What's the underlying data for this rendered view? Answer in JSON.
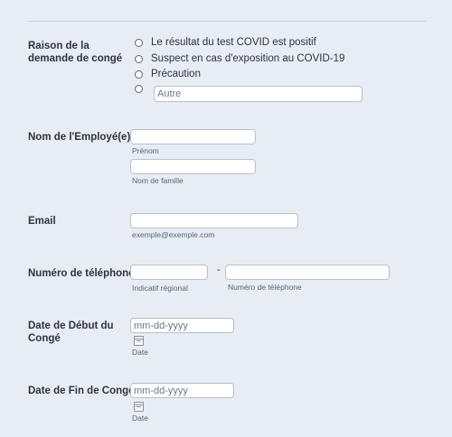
{
  "reason": {
    "label": "Raison de la demande de congé",
    "options": [
      "Le résultat du test COVID est positif",
      "Suspect en cas d'exposition au COVID-19",
      "Précaution"
    ],
    "other_placeholder": "Autre"
  },
  "employee_name": {
    "label": "Nom de l'Employé(e)",
    "first_sublabel": "Prénom",
    "last_sublabel": "Nom de famille"
  },
  "email": {
    "label": "Email",
    "sublabel": "exemple@exemple.com"
  },
  "phone": {
    "label": "Numéro de téléphone",
    "separator": "-",
    "area_sublabel": "Indicatif régional",
    "number_sublabel": "Numéro de téléphone"
  },
  "start_date": {
    "label": "Date de Début du Congé",
    "placeholder": "mm-dd-yyyy",
    "sublabel": "Date"
  },
  "end_date": {
    "label": "Date de Fin de Congé",
    "placeholder": "mm-dd-yyyy",
    "sublabel": "Date"
  }
}
